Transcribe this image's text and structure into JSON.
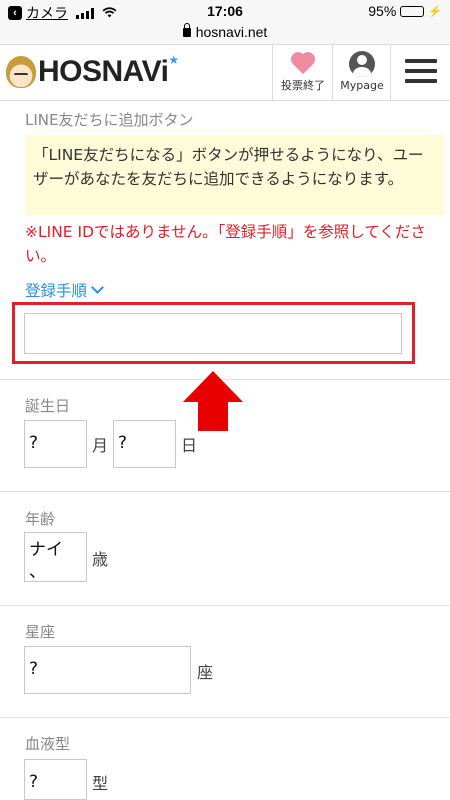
{
  "status_bar": {
    "back_label": "カメラ",
    "time": "17:06",
    "battery": "95%",
    "battery_level": 0.95,
    "url": "hosnavi.net"
  },
  "header": {
    "logo_text": "HOSNAVi",
    "vote_label": "投票終了",
    "mypage_label": "Mypage"
  },
  "line_section": {
    "label": "LINE友だちに追加ボタン",
    "notice": "「LINE友だちになる」ボタンが押せるようになり、ユーザーがあなたを友だちに追加できるようになります。",
    "warning": "※LINE IDではありません。「登録手順」を参照してください。",
    "link": "登録手順",
    "input_value": ""
  },
  "birthday_section": {
    "label": "誕生日",
    "month_value": "?",
    "month_suffix": "月",
    "day_value": "?",
    "day_suffix": "日"
  },
  "age_section": {
    "label": "年齢",
    "value_line1": "ナイ",
    "value_line2": "、",
    "suffix": "歳"
  },
  "zodiac_section": {
    "label": "星座",
    "value": "?",
    "suffix": "座"
  },
  "blood_section": {
    "label": "血液型",
    "value": "?",
    "suffix": "型"
  },
  "colors": {
    "accent_red": "#e0202a",
    "link_blue": "#2b8fd8",
    "notice_bg": "#fdfbd8"
  }
}
